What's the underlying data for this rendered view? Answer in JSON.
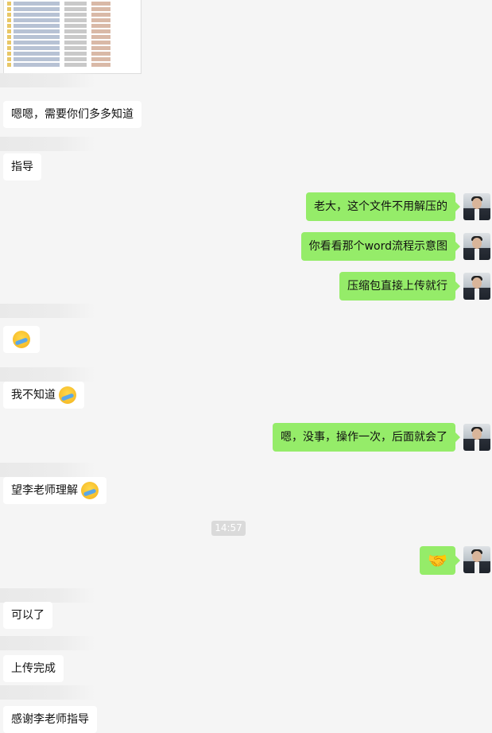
{
  "messages": {
    "in_1": "嗯嗯，需要你们多多知道",
    "in_2": "指导",
    "out_1": "老大，这个文件不用解压的",
    "out_2": "你看看那个word流程示意图",
    "out_3": "压缩包直接上传就行",
    "in_4": "我不知道",
    "out_4": "嗯，没事，操作一次，后面就会了",
    "in_5": "望李老师理解",
    "timestamp": "14:57",
    "out_5": "🤝",
    "in_6": "可以了",
    "in_7": "上传完成",
    "in_8": "感谢李老师指导"
  },
  "colors": {
    "background": "#f5f5f5",
    "outgoing_bubble": "#95ec69",
    "incoming_bubble": "#ffffff",
    "timestamp_chip": "#dadada"
  },
  "icons": {
    "emoji_1": "facepalm-emoji",
    "emoji_2": "facepalm-emoji",
    "emoji_3": "facepalm-emoji",
    "emoji_4": "facepalm-emoji",
    "handshake": "handshake-emoji",
    "avatar": "user-avatar"
  }
}
